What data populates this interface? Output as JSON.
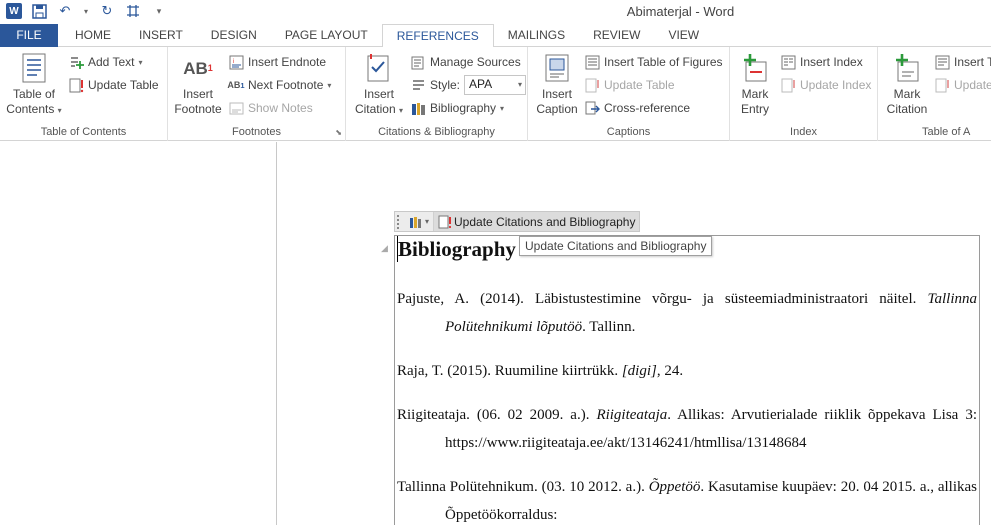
{
  "window": {
    "title": "Abimaterjal - Word"
  },
  "tabs": [
    "FILE",
    "HOME",
    "INSERT",
    "DESIGN",
    "PAGE LAYOUT",
    "REFERENCES",
    "MAILINGS",
    "REVIEW",
    "VIEW"
  ],
  "active_tab": "REFERENCES",
  "ribbon": {
    "toc": {
      "label": "Table of Contents",
      "big_button": {
        "line1": "Table of",
        "line2": "Contents"
      },
      "add_text": "Add Text",
      "update_table": "Update Table"
    },
    "footnotes": {
      "label": "Footnotes",
      "insert_footnote": {
        "line1": "Insert",
        "line2": "Footnote"
      },
      "insert_endnote": "Insert Endnote",
      "next_footnote": "Next Footnote",
      "show_notes": "Show Notes"
    },
    "citations": {
      "label": "Citations & Bibliography",
      "insert_citation": {
        "line1": "Insert",
        "line2": "Citation"
      },
      "manage_sources": "Manage Sources",
      "style_label": "Style:",
      "style_value": "APA",
      "bibliography": "Bibliography"
    },
    "captions": {
      "label": "Captions",
      "insert_caption": {
        "line1": "Insert",
        "line2": "Caption"
      },
      "insert_table_of_figures": "Insert Table of Figures",
      "update_table": "Update Table",
      "cross_reference": "Cross-reference"
    },
    "index": {
      "label": "Index",
      "mark_entry": {
        "line1": "Mark",
        "line2": "Entry"
      },
      "insert_index": "Insert Index",
      "update_index": "Update Index"
    },
    "authorities": {
      "label": "Table of A",
      "mark_citation": {
        "line1": "Mark",
        "line2": "Citation"
      },
      "insert_table": "Insert T",
      "update_table": "Update"
    }
  },
  "content_control": {
    "update_button": "Update Citations and Bibliography",
    "tooltip": "Update Citations and Bibliography"
  },
  "bibliography": {
    "heading": "Bibliography",
    "entries": [
      {
        "text1": "Pajuste, A. (2014). Läbistustestimine võrgu- ja süsteemiadministraatori näitel. ",
        "italic": "Tallinna Polütehnikumi lõputöö",
        "text2": ". Tallinn."
      },
      {
        "text1": "Raja, T. (2015). Ruumiline kiirtrükk. ",
        "italic": "[digi]",
        "text2": ", 24."
      },
      {
        "text1": "Riigiteataja. (06. 02 2009. a.). ",
        "italic": "Riigiteataja",
        "text2": ". Allikas: Arvutierialade riiklik õppekava Lisa 3: https://www.riigiteataja.ee/akt/13146241/htmllisa/13148684"
      },
      {
        "text1": "Tallinna Polütehnikum. (03. 10 2012. a.). ",
        "italic": "Õppetöö",
        "text2": ". Kasutamise kuupäev: 20. 04 2015. a., allikas Õppetöökorraldus:"
      }
    ]
  },
  "colors": {
    "accent": "#2b579a",
    "ribbon_bg": "#ffffff",
    "border": "#d4d4d4",
    "disabled": "#a6a6a6"
  }
}
